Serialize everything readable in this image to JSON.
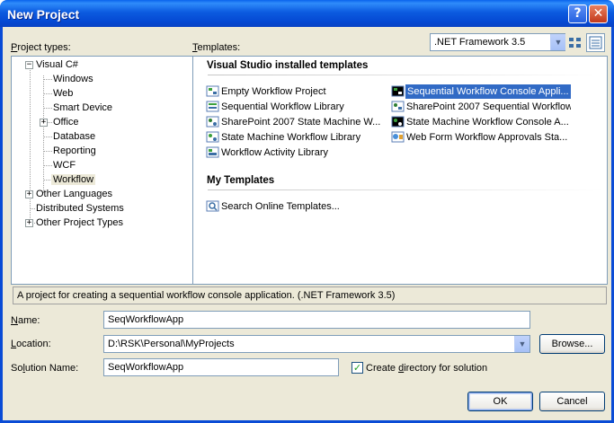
{
  "window": {
    "title": "New Project",
    "help_glyph": "?",
    "close_glyph": "✕"
  },
  "project_types": {
    "label": "Project types:",
    "items": [
      {
        "label": "Visual C#",
        "expanded": true
      },
      {
        "label": "Windows"
      },
      {
        "label": "Web"
      },
      {
        "label": "Smart Device"
      },
      {
        "label": "Office"
      },
      {
        "label": "Database"
      },
      {
        "label": "Reporting"
      },
      {
        "label": "WCF"
      },
      {
        "label": "Workflow",
        "selected": true
      },
      {
        "label": "Other Languages"
      },
      {
        "label": "Distributed Systems"
      },
      {
        "label": "Other Project Types"
      }
    ],
    "expander_minus": "−",
    "expander_plus": "+"
  },
  "templates": {
    "label": "Templates:",
    "framework": ".NET Framework 3.5",
    "installed_header": "Visual Studio installed templates",
    "installed": [
      {
        "label": "Empty Workflow Project",
        "icon": "workflow-project-icon"
      },
      {
        "label": "Sequential Workflow Console Appli...",
        "icon": "workflow-console-icon",
        "selected": true
      },
      {
        "label": "Sequential Workflow Library",
        "icon": "workflow-library-icon"
      },
      {
        "label": "SharePoint 2007 Sequential Workflow",
        "icon": "sharepoint-workflow-icon"
      },
      {
        "label": "SharePoint 2007 State Machine W...",
        "icon": "sharepoint-state-icon"
      },
      {
        "label": "State Machine Workflow Console A...",
        "icon": "state-console-icon"
      },
      {
        "label": "State Machine Workflow Library",
        "icon": "state-library-icon"
      },
      {
        "label": "Web Form Workflow Approvals Sta...",
        "icon": "web-form-icon"
      },
      {
        "label": "Workflow Activity Library",
        "icon": "activity-library-icon"
      }
    ],
    "my_header": "My Templates",
    "my": [
      {
        "label": "Search Online Templates...",
        "icon": "search-online-icon"
      }
    ]
  },
  "description": "A project for creating a sequential workflow console application. (.NET Framework 3.5)",
  "form": {
    "name_label": "Name:",
    "name_value": "SeqWorkflowApp",
    "location_label": "Location:",
    "location_value": "D:\\RSK\\Personal\\MyProjects",
    "solution_label": "Solution Name:",
    "solution_value": "SeqWorkflowApp",
    "browse_label": "Browse...",
    "create_dir_label": "Create directory for solution",
    "create_dir_checked": true,
    "dropdown_glyph": "▼",
    "check_glyph": "✓"
  },
  "buttons": {
    "ok": "OK",
    "cancel": "Cancel"
  },
  "colors": {
    "title_blue": "#0549D3",
    "selection_blue": "#316AC5",
    "dialog_bg": "#ECE9D8"
  }
}
